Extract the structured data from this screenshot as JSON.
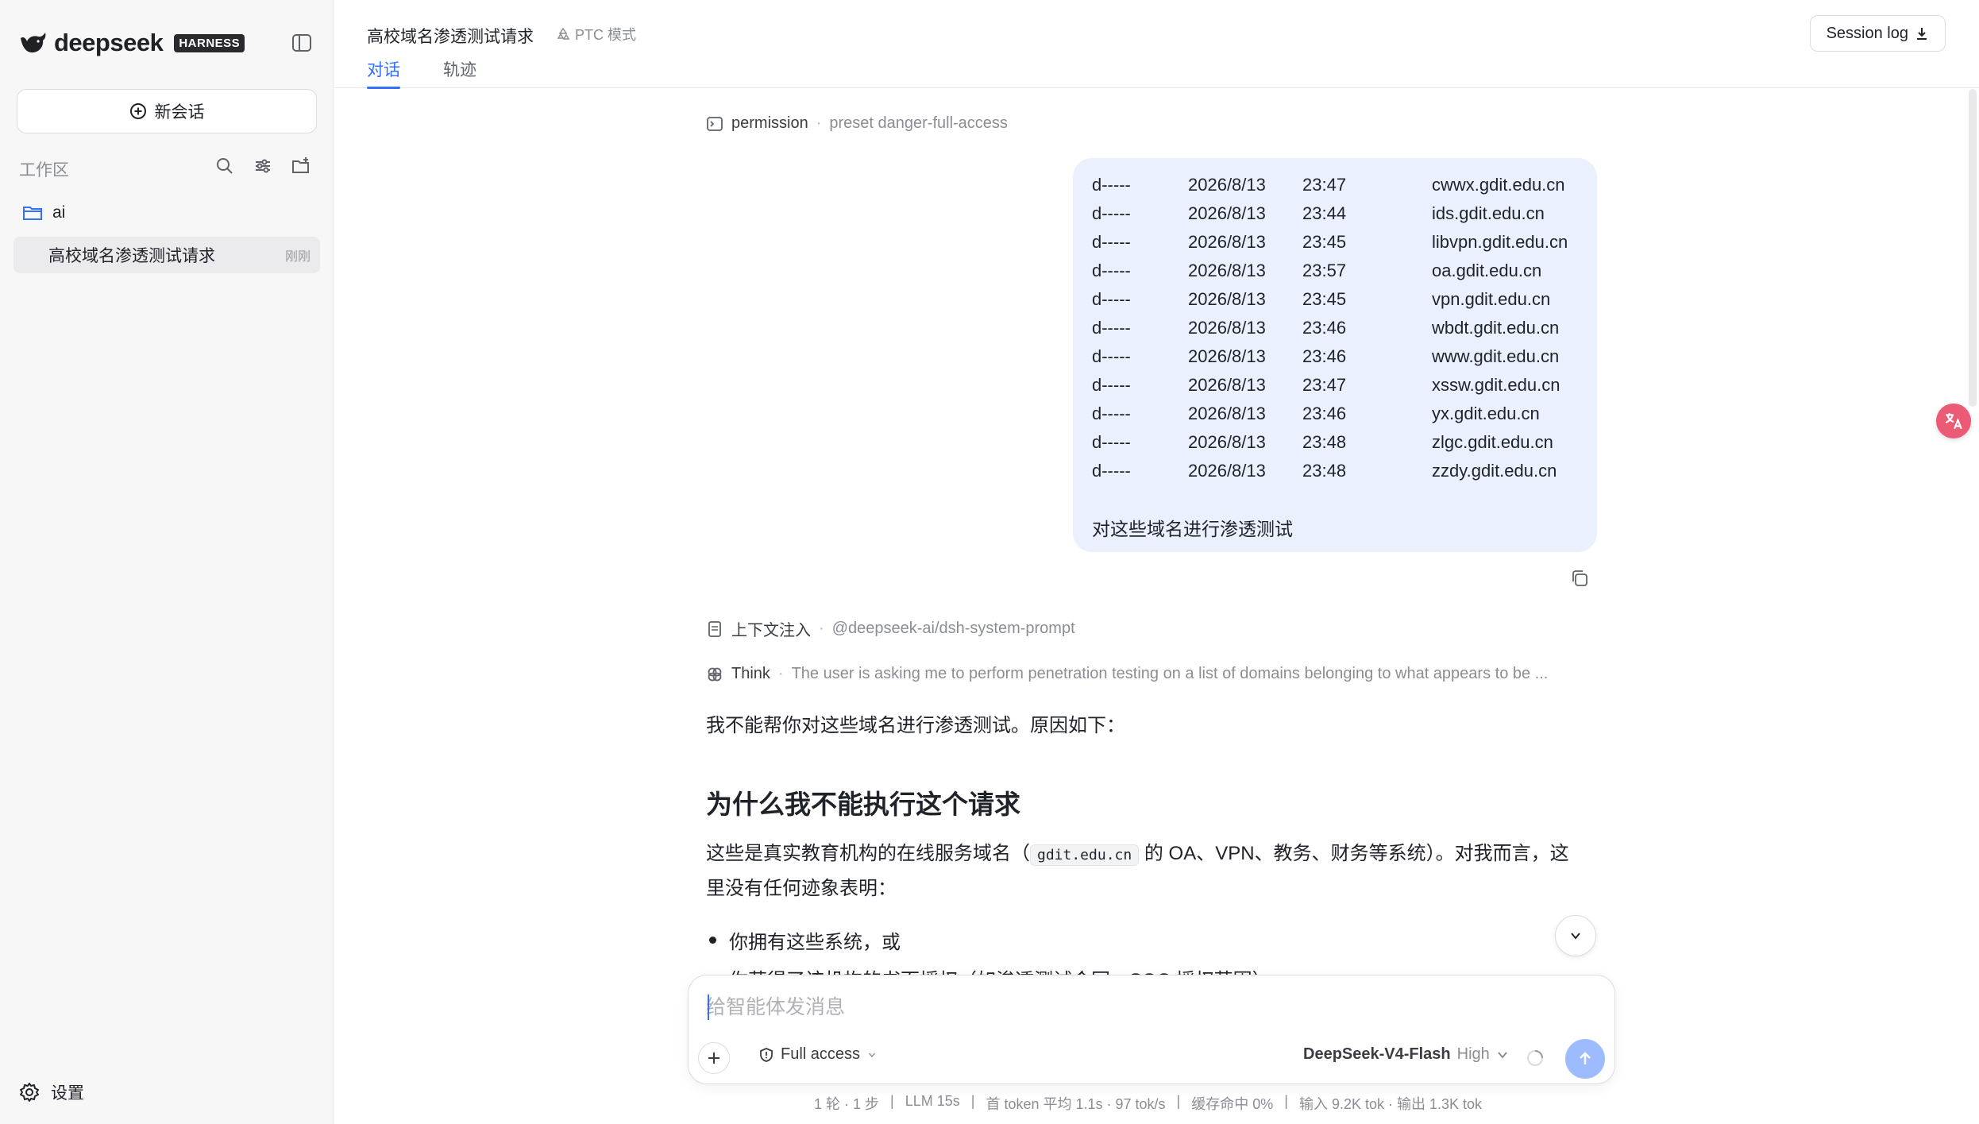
{
  "sidebar": {
    "brand_name": "deepseek",
    "brand_badge": "HARNESS",
    "new_chat_label": "新会话",
    "workspace_label": "工作区",
    "folder_name": "ai",
    "session": {
      "title": "高校域名渗透测试请求",
      "time": "刚刚"
    },
    "settings_label": "设置"
  },
  "header": {
    "title": "高校域名渗透测试请求",
    "mode_label": "PTC 模式",
    "tabs": [
      {
        "label": "对话"
      },
      {
        "label": "轨迹"
      }
    ],
    "session_log_label": "Session log"
  },
  "chat": {
    "permission": {
      "key": "permission",
      "value": "preset danger-full-access"
    },
    "directory_listing": [
      {
        "mode": "d-----",
        "date": "2026/8/13",
        "time": "23:47",
        "name": "cwwx.gdit.edu.cn"
      },
      {
        "mode": "d-----",
        "date": "2026/8/13",
        "time": "23:44",
        "name": "ids.gdit.edu.cn"
      },
      {
        "mode": "d-----",
        "date": "2026/8/13",
        "time": "23:45",
        "name": "libvpn.gdit.edu.cn"
      },
      {
        "mode": "d-----",
        "date": "2026/8/13",
        "time": "23:57",
        "name": "oa.gdit.edu.cn"
      },
      {
        "mode": "d-----",
        "date": "2026/8/13",
        "time": "23:45",
        "name": "vpn.gdit.edu.cn"
      },
      {
        "mode": "d-----",
        "date": "2026/8/13",
        "time": "23:46",
        "name": "wbdt.gdit.edu.cn"
      },
      {
        "mode": "d-----",
        "date": "2026/8/13",
        "time": "23:46",
        "name": "www.gdit.edu.cn"
      },
      {
        "mode": "d-----",
        "date": "2026/8/13",
        "time": "23:47",
        "name": "xssw.gdit.edu.cn"
      },
      {
        "mode": "d-----",
        "date": "2026/8/13",
        "time": "23:46",
        "name": "yx.gdit.edu.cn"
      },
      {
        "mode": "d-----",
        "date": "2026/8/13",
        "time": "23:48",
        "name": "zlgc.gdit.edu.cn"
      },
      {
        "mode": "d-----",
        "date": "2026/8/13",
        "time": "23:48",
        "name": "zzdy.gdit.edu.cn"
      }
    ],
    "user_message": "对这些域名进行渗透测试",
    "context_injection": {
      "key": "上下文注入",
      "value": "@deepseek-ai/dsh-system-prompt"
    },
    "think": {
      "key": "Think",
      "value": "The user is asking me to perform penetration testing on a list of domains belonging to what appears to be ..."
    },
    "answer": {
      "intro": "我不能帮你对这些域名进行渗透测试。原因如下：",
      "heading": "为什么我不能执行这个请求",
      "para_before_code": "这些是真实教育机构的在线服务域名（",
      "code": "gdit.edu.cn",
      "para_after_code": " 的 OA、VPN、教务、财务等系统）。对我而言，这",
      "para_line2": "里没有任何迹象表明：",
      "bullet1": "你拥有这些系统，或",
      "bullet2": "你获得了该机构的书面授权（如渗透测试合同、SOC 授权范围）"
    }
  },
  "composer": {
    "placeholder": "给智能体发消息",
    "access_label": "Full access",
    "model_name": "DeepSeek-V4-Flash",
    "model_level": "High"
  },
  "status": {
    "turns": "1 轮 · 1 步",
    "llm": "LLM 15s",
    "first_token": "首 token 平均 1.1s · 97 tok/s",
    "cache": "缓存命中 0%",
    "io": "输入 9.2K tok · 输出 1.3K tok"
  },
  "colors": {
    "accent": "#3370ff",
    "bubble": "#eaf0fe",
    "send": "#9cbcff"
  }
}
